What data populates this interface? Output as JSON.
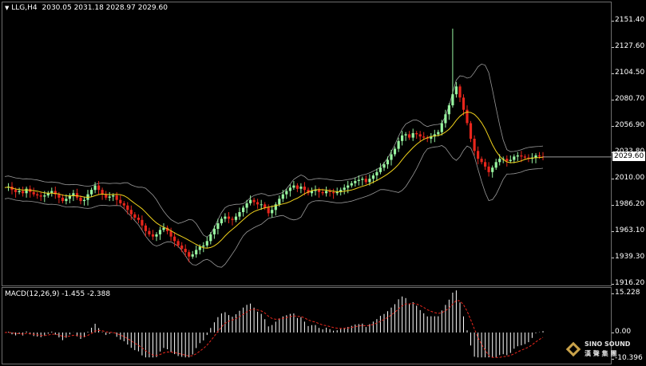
{
  "header": {
    "menu_icon": "triangle-down-icon",
    "symbol": "LLG,H4",
    "ohlc": "2030.05 2031.18 2028.97 2029.60"
  },
  "price_axis": {
    "ticks": [
      "2151.40",
      "2127.60",
      "2104.50",
      "2080.70",
      "2056.90",
      "2033.80",
      "2010.00",
      "1986.20",
      "1963.10",
      "1939.30",
      "1916.20"
    ],
    "current_price": "2029.60"
  },
  "macd": {
    "label": "MACD(12,26,9) -1.455 -2.388",
    "ticks": [
      "15.228",
      "0.00",
      "-10.396"
    ]
  },
  "logo": {
    "line1": "SINO SOUND",
    "line2": "漢 聲 集 團"
  },
  "colors": {
    "background": "#000000",
    "bull_candle": "#98f5a0",
    "bear_candle": "#e8261c",
    "ma_line": "#f1d21b",
    "bands": "#9a9a9a",
    "signal_line": "#e8261c",
    "histogram": "#ffffff"
  },
  "chart_data": [
    {
      "type": "candlestick",
      "symbol": "LLG",
      "timeframe": "H4",
      "ylim": [
        1916.2,
        2151.4
      ],
      "last_close": 2029.6,
      "closes": [
        2002,
        2003,
        2000,
        1998,
        1999,
        1997,
        2001,
        1998,
        1996,
        1995,
        1994,
        1995,
        1997,
        1999,
        1996,
        1993,
        1990,
        1992,
        1995,
        1997,
        1993,
        1990,
        1991,
        1996,
        2000,
        2004,
        2000,
        1996,
        1993,
        1994,
        1995,
        1991,
        1988,
        1986,
        1982,
        1978,
        1975,
        1973,
        1968,
        1963,
        1960,
        1958,
        1960,
        1964,
        1966,
        1963,
        1958,
        1954,
        1950,
        1947,
        1944,
        1940,
        1942,
        1946,
        1949,
        1950,
        1954,
        1960,
        1965,
        1970,
        1974,
        1976,
        1974,
        1973,
        1976,
        1980,
        1984,
        1988,
        1991,
        1989,
        1987,
        1987,
        1984,
        1979,
        1982,
        1987,
        1992,
        1996,
        1999,
        2002,
        2004,
        2001,
        2003,
        2000,
        1997,
        1999,
        2000,
        1998,
        1997,
        1999,
        1998,
        1997,
        1998,
        2000,
        2002,
        2004,
        2006,
        2008,
        2009,
        2010,
        2007,
        2010,
        2013,
        2016,
        2020,
        2023,
        2027,
        2032,
        2037,
        2044,
        2049,
        2050,
        2047,
        2051,
        2050,
        2048,
        2047,
        2046,
        2048,
        2050,
        2052,
        2060,
        2068,
        2076,
        2086,
        2093,
        2083,
        2072,
        2060,
        2046,
        2035,
        2028,
        2025,
        2021,
        2016,
        2020,
        2025,
        2028,
        2028,
        2026,
        2027,
        2030,
        2031,
        2030,
        2029,
        2028,
        2029,
        2031,
        2030,
        2029.6
      ]
    },
    {
      "type": "line",
      "name": "MACD(12,26,9)",
      "main_value": -1.455,
      "signal_value": -2.388,
      "ylim": [
        -10.396,
        15.228
      ]
    }
  ]
}
